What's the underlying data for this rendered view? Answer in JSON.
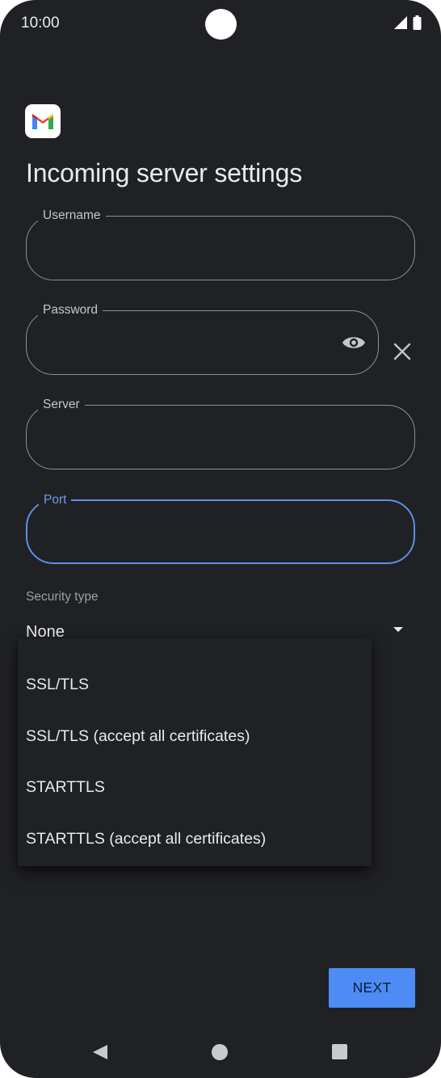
{
  "status_bar": {
    "time": "10:00"
  },
  "app": {
    "logo_icon": "gmail-icon"
  },
  "page": {
    "title": "Incoming server settings"
  },
  "fields": {
    "username": {
      "label": "Username",
      "value": ""
    },
    "password": {
      "label": "Password",
      "value": ""
    },
    "server": {
      "label": "Server",
      "value": ""
    },
    "port": {
      "label": "Port",
      "value": ""
    }
  },
  "security": {
    "label": "Security type",
    "selected": "None",
    "options": [
      "SSL/TLS",
      "SSL/TLS (accept all certificates)",
      "STARTTLS",
      "STARTTLS (accept all certificates)"
    ]
  },
  "actions": {
    "next_label": "NEXT"
  },
  "colors": {
    "background": "#202124",
    "accent": "#5c8fe6",
    "button": "#4d8cf5"
  }
}
